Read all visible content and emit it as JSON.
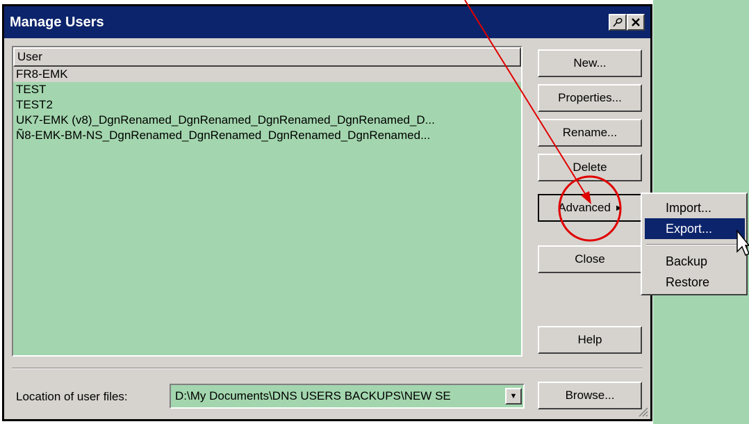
{
  "dialog": {
    "title": "Manage Users"
  },
  "user_list": {
    "column_header": "User",
    "rows": [
      "FR8-EMK",
      "TEST",
      "TEST2",
      "UK7-EMK (v8)_DgnRenamed_DgnRenamed_DgnRenamed_DgnRenamed_D...",
      "Ñ8-EMK-BM-NS_DgnRenamed_DgnRenamed_DgnRenamed_DgnRenamed..."
    ]
  },
  "buttons": {
    "new": "New...",
    "properties": "Properties...",
    "rename": "Rename...",
    "delete": "Delete",
    "advanced": "Advanced",
    "close": "Close",
    "help": "Help",
    "browse": "Browse..."
  },
  "location": {
    "label": "Location of user files:",
    "value": "D:\\My Documents\\DNS USERS BACKUPS\\NEW SE"
  },
  "context_menu": {
    "items": [
      "Import...",
      "Export...",
      "Backup",
      "Restore"
    ],
    "highlighted": "Export..."
  },
  "icons": {
    "pin": "pin-icon",
    "close": "close-icon",
    "dropdown": "chevron-down-icon",
    "submenu": "chevron-right-icon",
    "cursor": "mouse-pointer-icon"
  },
  "colors": {
    "titlebar": "#0c246b",
    "list_bg": "#a3d6ae",
    "dialog_bg": "#d6d3ce",
    "annotation": "#e00000"
  }
}
